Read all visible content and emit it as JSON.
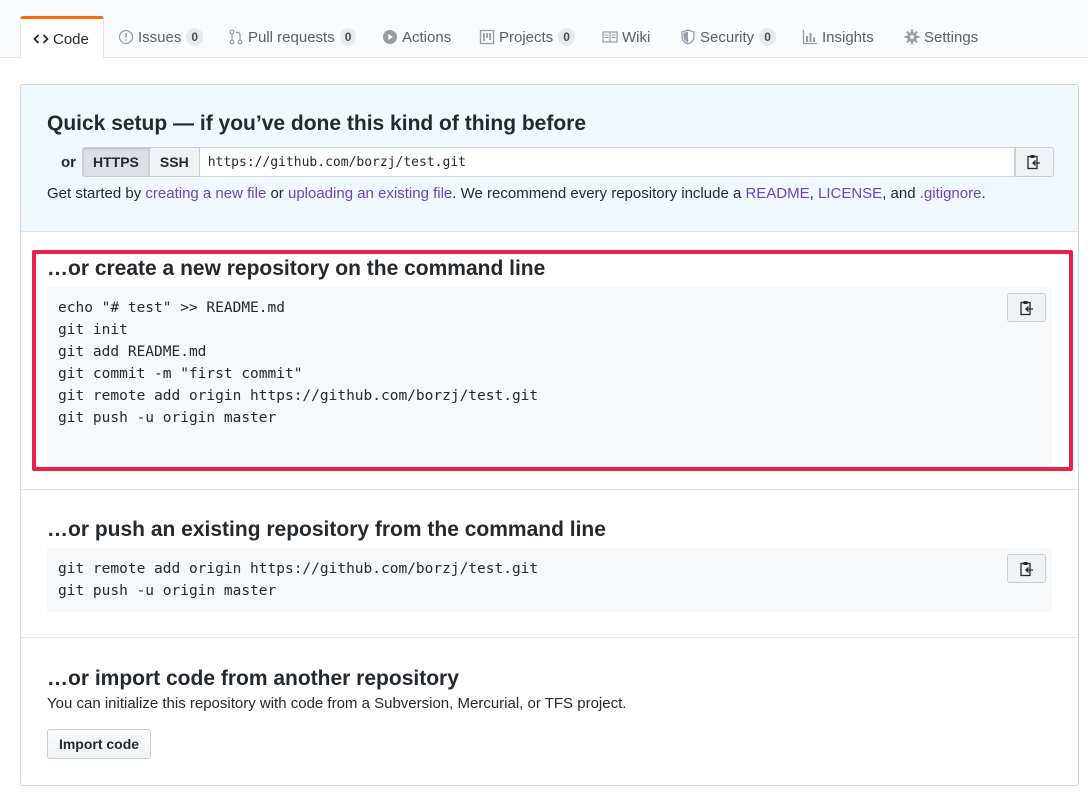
{
  "tabs": [
    {
      "label": "Code",
      "icon": "code-icon",
      "selected": true
    },
    {
      "label": "Issues",
      "icon": "issue-icon",
      "count": "0"
    },
    {
      "label": "Pull requests",
      "icon": "pull-request-icon",
      "count": "0"
    },
    {
      "label": "Actions",
      "icon": "play-icon"
    },
    {
      "label": "Projects",
      "icon": "project-icon",
      "count": "0"
    },
    {
      "label": "Wiki",
      "icon": "book-icon"
    },
    {
      "label": "Security",
      "icon": "shield-icon",
      "count": "0"
    },
    {
      "label": "Insights",
      "icon": "graph-icon"
    },
    {
      "label": "Settings",
      "icon": "gear-icon"
    }
  ],
  "quick_setup": {
    "title": "Quick setup — if you’ve done this kind of thing before",
    "or_label": "or",
    "https_label": "HTTPS",
    "ssh_label": "SSH",
    "clone_url": "https://github.com/borzj/test.git",
    "hint": {
      "t1": "Get started by ",
      "link1": "creating a new file",
      "t2": " or ",
      "link2": "uploading an existing file",
      "t3": ". We recommend every repository include a ",
      "link3": "README",
      "t4": ", ",
      "link4": "LICENSE",
      "t5": ", and ",
      "link5": ".gitignore",
      "t6": "."
    }
  },
  "create_section": {
    "title": "…or create a new repository on the command line",
    "lines": [
      "echo \"# test\" >> README.md",
      "git init",
      "git add README.md",
      "git commit -m \"first commit\"",
      "git remote add origin https://github.com/borzj/test.git",
      "git push -u origin master"
    ]
  },
  "push_section": {
    "title": "…or push an existing repository from the command line",
    "lines": [
      "git remote add origin https://github.com/borzj/test.git",
      "git push -u origin master"
    ]
  },
  "import_section": {
    "title": "…or import code from another repository",
    "description": "You can initialize this repository with code from a Subversion, Mercurial, or TFS project.",
    "button_label": "Import code"
  },
  "colors": {
    "accent_tab": "#f66a0a",
    "link": "#6f42c1",
    "highlight_border": "#e8234a",
    "quick_setup_bg": "#f1f8ff"
  }
}
